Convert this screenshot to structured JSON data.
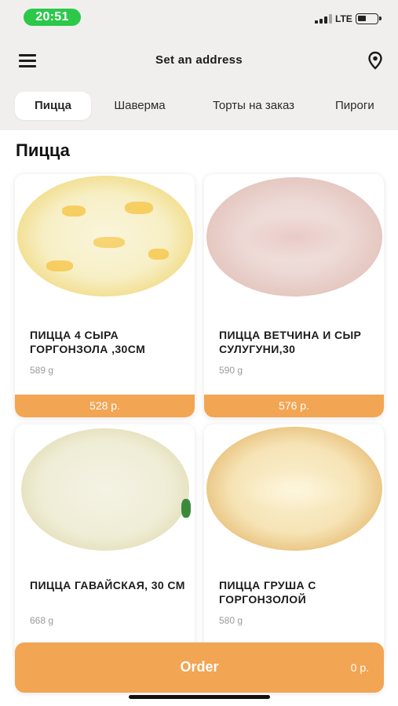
{
  "status_bar": {
    "time": "20:51",
    "network": "LTE",
    "time_pill_color": "#2cc84a"
  },
  "header": {
    "title": "Set an address",
    "menu_icon": "hamburger-menu-icon",
    "location_icon": "map-pin-icon"
  },
  "tabs": [
    {
      "label": "Пицца",
      "active": true
    },
    {
      "label": "Шаверма",
      "active": false
    },
    {
      "label": "Торты на заказ",
      "active": false
    },
    {
      "label": "Пироги",
      "active": false
    }
  ],
  "section": {
    "title": "Пицца"
  },
  "products": [
    {
      "name": "ПИЦЦА 4 СЫРА ГОРГОНЗОЛА ,30СМ",
      "weight": "589 g",
      "price": "528 р."
    },
    {
      "name": "ПИЦЦА ВЕТЧИНА И СЫР СУЛУГУНИ,30",
      "weight": "590 g",
      "price": "576 р."
    },
    {
      "name": "ПИЦЦА ГАВАЙСКАЯ, 30 СМ",
      "weight": "668 g",
      "price": ""
    },
    {
      "name": "ПИЦЦА ГРУША С ГОРГОНЗОЛОЙ",
      "weight": "580 g",
      "price": ""
    }
  ],
  "order": {
    "label": "Order",
    "total": "0 р."
  },
  "colors": {
    "accent": "#f2a553",
    "background": "#f0efed",
    "card": "#ffffff"
  }
}
